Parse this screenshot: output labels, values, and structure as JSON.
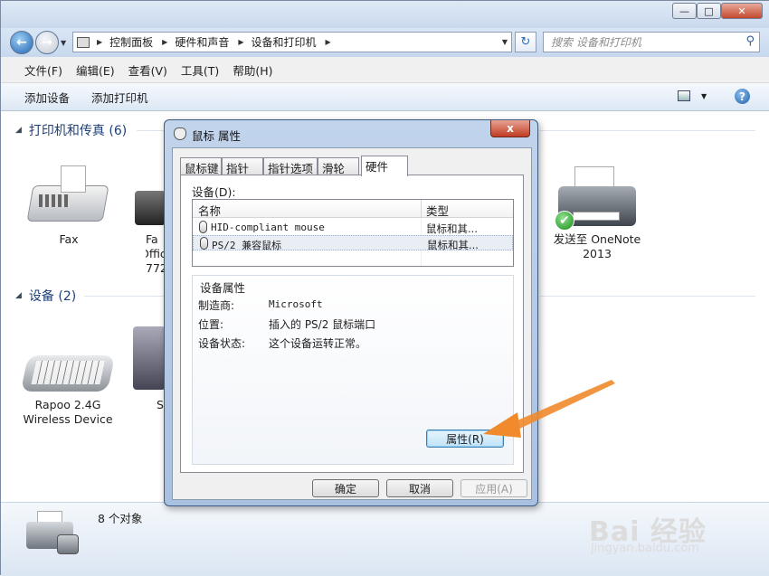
{
  "nav": {
    "breadcrumb": [
      "控制面板",
      "硬件和声音",
      "设备和打印机"
    ],
    "search_placeholder": "搜索 设备和打印机"
  },
  "menu": [
    "文件(F)",
    "编辑(E)",
    "查看(V)",
    "工具(T)",
    "帮助(H)"
  ],
  "commands": [
    "添加设备",
    "添加打印机"
  ],
  "groups": {
    "printers": "打印机和传真 (6)",
    "devices": "设备 (2)"
  },
  "printers": [
    {
      "label": "Fax"
    },
    {
      "label_line1": "Fa",
      "label_line2": "Offic",
      "label_line3": "772("
    },
    {
      "label_line1": "发送至 OneNote",
      "label_line2": "2013"
    }
  ],
  "devices": [
    {
      "label_line1": "Rapoo 2.4G",
      "label_line2": "Wireless Device"
    },
    {
      "label": "S"
    }
  ],
  "status": {
    "count": "8 个对象"
  },
  "dialog": {
    "title": "鼠标 属性",
    "close": "x",
    "tabs": [
      "鼠标键",
      "指针",
      "指针选项",
      "滑轮",
      "硬件"
    ],
    "active_tab": "硬件",
    "devices_label": "设备(D):",
    "columns": [
      "名称",
      "类型"
    ],
    "rows": [
      {
        "name": "HID-compliant mouse",
        "type": "鼠标和其..."
      },
      {
        "name": "PS/2 兼容鼠标",
        "type": "鼠标和其..."
      }
    ],
    "props": {
      "title": "设备属性",
      "manufacturer_label": "制造商:",
      "manufacturer": "Microsoft",
      "location_label": "位置:",
      "location": "插入的 PS/2 鼠标端口",
      "state_label": "设备状态:",
      "state": "这个设备运转正常。",
      "properties_button": "属性(R)"
    },
    "ok": "确定",
    "cancel": "取消",
    "apply": "应用(A)"
  },
  "watermark": {
    "main": "Bai 经验",
    "sub": "jingyan.baidu.com"
  },
  "colors": {
    "accent_arrow": "#f08a2c",
    "group_text": "#1e3f7a",
    "close_red": "#c13c22"
  }
}
